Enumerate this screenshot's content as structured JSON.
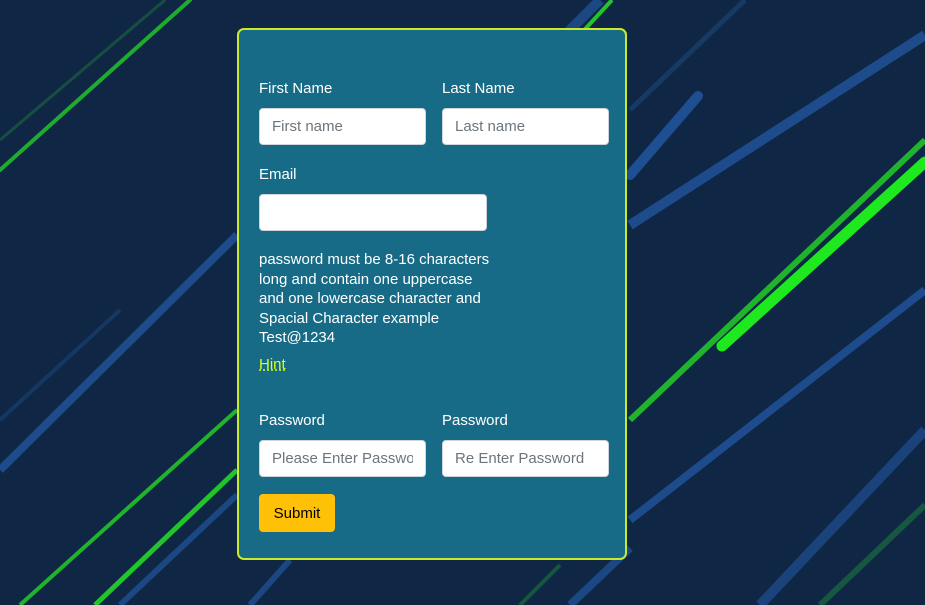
{
  "form": {
    "first_name": {
      "label": "First Name",
      "placeholder": "First name",
      "value": ""
    },
    "last_name": {
      "label": "Last Name",
      "placeholder": "Last name",
      "value": ""
    },
    "email": {
      "label": "Email",
      "placeholder": "",
      "value": ""
    },
    "password_hint_text": "password must be 8-16 characters long and contain one uppercase and one lowercase character and Spacial Character example Test@1234",
    "hint_link": "Hint",
    "password": {
      "label": "Password",
      "placeholder": "Please Enter Password",
      "value": ""
    },
    "confirm_password": {
      "label": "Password",
      "placeholder": "Re Enter Password",
      "value": ""
    },
    "submit_label": "Submit"
  },
  "colors": {
    "page_background": "#0f2745",
    "card_background": "#176b87",
    "card_border": "#c9ea2a",
    "hint_link": "#d9ff1e",
    "submit_button": "#ffc107",
    "stripe_green": "#22c42b",
    "stripe_bright_green": "#1ee81e",
    "stripe_blue": "#1f4f93"
  }
}
